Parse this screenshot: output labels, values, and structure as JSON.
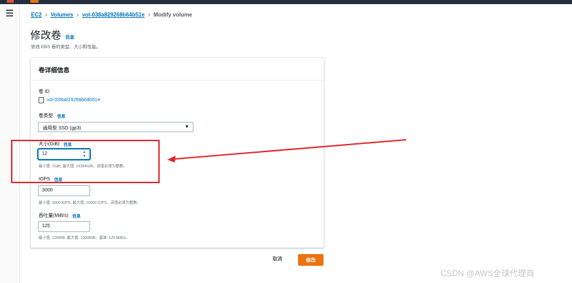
{
  "breadcrumb": {
    "items": [
      "EC2",
      "Volumes",
      "vol-038a829268b64b51e"
    ],
    "current": "Modify volume"
  },
  "page": {
    "title": "修改卷",
    "info": "信息",
    "description": "修改 EBS 卷的类型、大小和性能。"
  },
  "panel": {
    "title": "卷详细信息",
    "volume_id_label": "卷 ID",
    "volume_id": "vol-038a829268b64b51e",
    "type_label": "卷类型",
    "type_info": "信息",
    "type_value": "通用型 SSD (gp3)",
    "size_label": "大小(GiB)",
    "size_info": "信息",
    "size_value": "12",
    "size_hint": "最小值: 1GiB; 最大值: 16384GiB。该值必须为整数。",
    "iops_label": "IOPS",
    "iops_info": "信息",
    "iops_value": "3000",
    "iops_hint": "最小值: 3000 IOPS; 最大值: 16000 IOPS。该值必须为整数。",
    "throughput_label": "吞吐量(MiB/s)",
    "throughput_info": "信息",
    "throughput_value": "125",
    "throughput_hint": "最小值: 125MiB; 最大值: 1000MiB。基准: 125 MiB/s。"
  },
  "actions": {
    "cancel": "取消",
    "modify": "修改"
  },
  "watermark": "CSDN @AWS全球代理商",
  "colors": {
    "accent": "#0073bb",
    "primary_button": "#ec7211",
    "annotation": "#e0262d",
    "topbar": "#232f3e"
  }
}
